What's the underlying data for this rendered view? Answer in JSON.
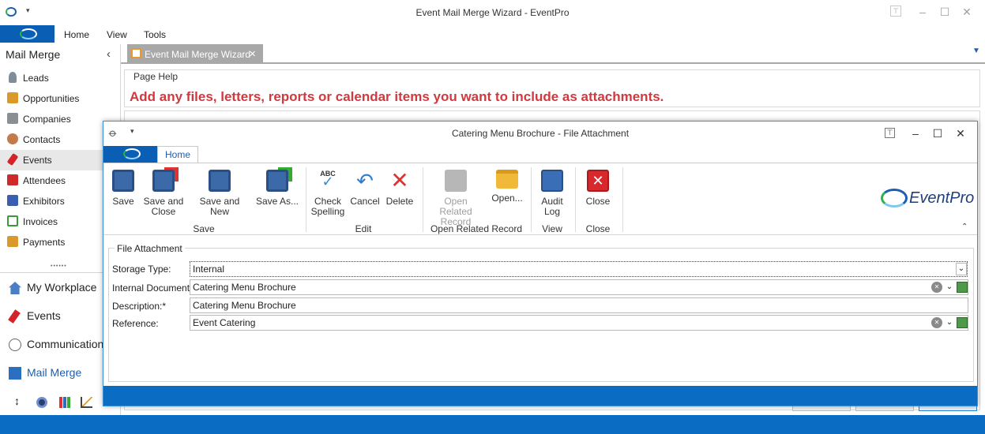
{
  "window": {
    "title": "Event Mail Merge Wizard - EventPro"
  },
  "menu": {
    "home": "Home",
    "view": "View",
    "tools": "Tools"
  },
  "sidebar": {
    "title": "Mail Merge",
    "items": [
      {
        "label": "Leads"
      },
      {
        "label": "Opportunities"
      },
      {
        "label": "Companies"
      },
      {
        "label": "Contacts"
      },
      {
        "label": "Events"
      },
      {
        "label": "Attendees"
      },
      {
        "label": "Exhibitors"
      },
      {
        "label": "Invoices"
      },
      {
        "label": "Payments"
      }
    ],
    "grip": "••••••",
    "nav": [
      {
        "label": "My Workplace"
      },
      {
        "label": "Events"
      },
      {
        "label": "Communication"
      },
      {
        "label": "Mail Merge"
      }
    ]
  },
  "tab": {
    "label": "Event Mail Merge Wizard",
    "close": "✕"
  },
  "page_help": {
    "legend": "Page Help",
    "text": "Add any files, letters, reports or calendar items you want to include as attachments."
  },
  "dialog": {
    "title": "Catering Menu Brochure - File Attachment",
    "home_tab": "Home",
    "brand": "EventPro",
    "buttons": {
      "save": "Save",
      "save_close": [
        "Save and",
        "Close"
      ],
      "save_new": "Save and New",
      "save_as": "Save As...",
      "check": [
        "Check",
        "Spelling"
      ],
      "cancel": "Cancel",
      "delete": "Delete",
      "open_related": [
        "Open Related",
        "Record"
      ],
      "open": "Open...",
      "audit": [
        "Audit",
        "Log"
      ],
      "close": "Close"
    },
    "groups": {
      "save": "Save",
      "edit": "Edit",
      "open_related": "Open Related Record",
      "view": "View",
      "close": "Close"
    },
    "form": {
      "legend": "File Attachment",
      "storage_type_label": "Storage Type:",
      "storage_type_value": "Internal",
      "internal_doc_label": "Internal Document:",
      "internal_doc_value": "Catering Menu Brochure",
      "description_label": "Description:*",
      "description_value": "Catering Menu Brochure",
      "reference_label": "Reference:",
      "reference_value": "Event Catering"
    }
  },
  "colors": {
    "accent": "#0a5fb4",
    "status": "#0a6cc2",
    "help": "#d0393f"
  }
}
